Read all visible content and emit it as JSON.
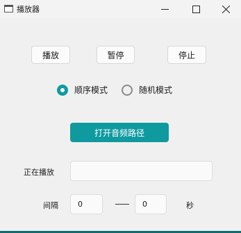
{
  "window": {
    "title": "播放器",
    "icon": "app-icon",
    "controls": [
      "minimize-icon",
      "maximize-icon",
      "close-icon"
    ]
  },
  "buttons": {
    "play": "播放",
    "pause": "暂停",
    "stop": "停止",
    "open_path": "打开音频路径"
  },
  "mode": {
    "sequential": {
      "label": "顺序模式",
      "checked": true
    },
    "random": {
      "label": "随机模式",
      "checked": false
    }
  },
  "now_playing": {
    "label": "正在播放",
    "value": ""
  },
  "interval": {
    "label": "间隔",
    "from": "0",
    "to": "0",
    "unit": "秒"
  },
  "colors": {
    "accent": "#0f9aa0",
    "bottom_bar": "#0f6a73"
  }
}
